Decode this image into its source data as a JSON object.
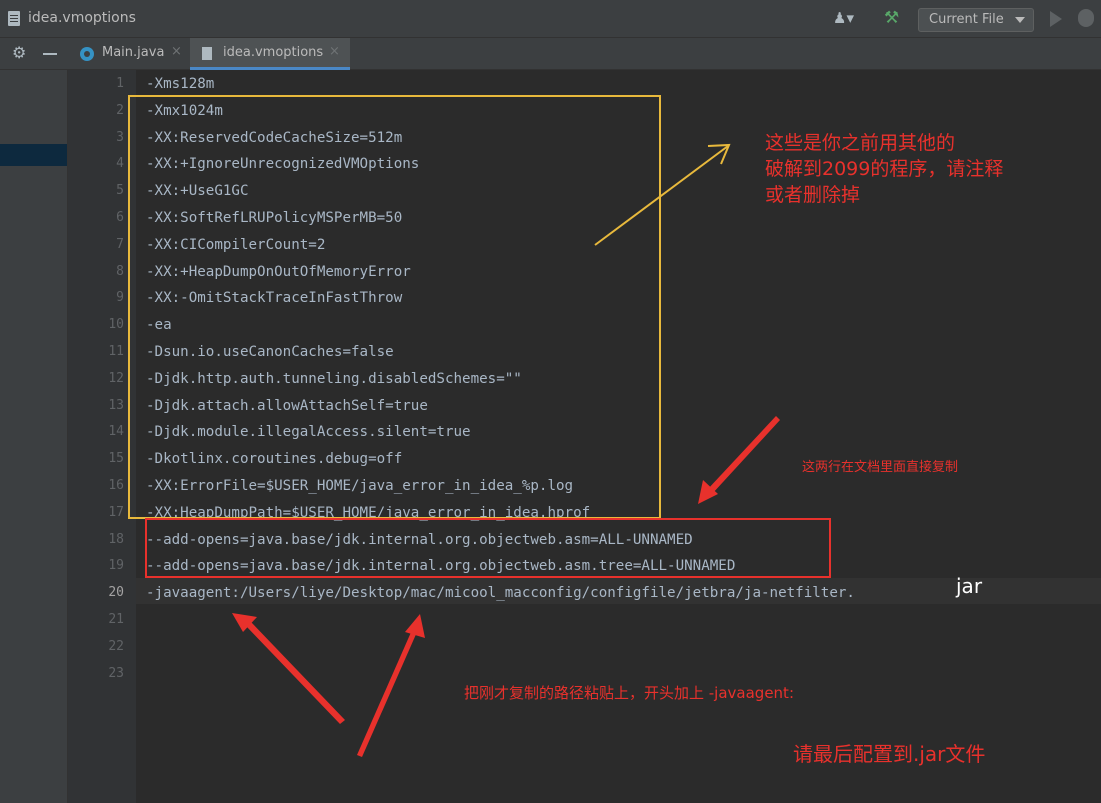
{
  "window": {
    "title": "idea.vmoptions"
  },
  "toolbar": {
    "run_config_label": "Current File"
  },
  "tabs": [
    {
      "label": "Main.java",
      "close": "×"
    },
    {
      "label": "idea.vmoptions",
      "close": "×"
    }
  ],
  "editor": {
    "current_line": 20,
    "lines": [
      {
        "num": "1",
        "text": "-Xms128m"
      },
      {
        "num": "2",
        "text": "-Xmx1024m"
      },
      {
        "num": "3",
        "text": "-XX:ReservedCodeCacheSize=512m"
      },
      {
        "num": "4",
        "text": "-XX:+IgnoreUnrecognizedVMOptions"
      },
      {
        "num": "5",
        "text": "-XX:+UseG1GC"
      },
      {
        "num": "6",
        "text": "-XX:SoftRefLRUPolicyMSPerMB=50"
      },
      {
        "num": "7",
        "text": "-XX:CICompilerCount=2"
      },
      {
        "num": "8",
        "text": "-XX:+HeapDumpOnOutOfMemoryError"
      },
      {
        "num": "9",
        "text": "-XX:-OmitStackTraceInFastThrow"
      },
      {
        "num": "10",
        "text": "-ea"
      },
      {
        "num": "11",
        "text": "-Dsun.io.useCanonCaches=false"
      },
      {
        "num": "12",
        "text": "-Djdk.http.auth.tunneling.disabledSchemes=\"\""
      },
      {
        "num": "13",
        "text": "-Djdk.attach.allowAttachSelf=true"
      },
      {
        "num": "14",
        "text": "-Djdk.module.illegalAccess.silent=true"
      },
      {
        "num": "15",
        "text": "-Dkotlinx.coroutines.debug=off"
      },
      {
        "num": "16",
        "text": "-XX:ErrorFile=$USER_HOME/java_error_in_idea_%p.log"
      },
      {
        "num": "17",
        "text": "-XX:HeapDumpPath=$USER_HOME/java_error_in_idea.hprof"
      },
      {
        "num": "18",
        "text": "--add-opens=java.base/jdk.internal.org.objectweb.asm=ALL-UNNAMED"
      },
      {
        "num": "19",
        "text": "--add-opens=java.base/jdk.internal.org.objectweb.asm.tree=ALL-UNNAMED"
      },
      {
        "num": "20",
        "text": "-javaagent:/Users/liye/Desktop/mac/micool_macconfig/configfile/jetbra/ja-netfilter."
      },
      {
        "num": "21",
        "text": ""
      },
      {
        "num": "22",
        "text": ""
      },
      {
        "num": "23",
        "text": ""
      }
    ]
  },
  "annotations": {
    "yellow_note_line1": "这些是你之前用其他的",
    "yellow_note_line2": "破解到2099的程序，请注释",
    "yellow_note_line3": "或者删除掉",
    "red_note_copy": "这两行在文档里面直接复制",
    "paste_note": "把刚才复制的路径粘贴上，开头加上 -javaagent:",
    "jar_note": "请最后配置到.jar文件",
    "jar_suffix": "jar",
    "colors": {
      "yellow": "#e8b93c",
      "red": "#e8312c"
    }
  },
  "icons": [
    "file-icon",
    "user-icon",
    "hammer-icon",
    "play-icon",
    "bug-icon",
    "gear-icon",
    "minus-icon",
    "java-class-icon",
    "text-file-icon"
  ]
}
